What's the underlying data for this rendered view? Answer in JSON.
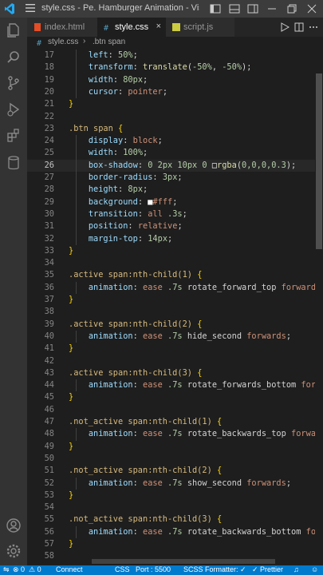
{
  "window": {
    "title": "style.css - Pe. Hamburger Animation - Visual Studio ..."
  },
  "tabs": [
    {
      "label": "index.html",
      "active": false,
      "icon": "html-file-icon",
      "icon_color": "#e44d26"
    },
    {
      "label": "style.css",
      "active": true,
      "icon": "css-file-icon",
      "icon_color": "#519aba",
      "close": "×"
    },
    {
      "label": "script.js",
      "active": false,
      "icon": "js-file-icon",
      "icon_color": "#cbcb41"
    }
  ],
  "breadcrumb": {
    "file": "style.css",
    "separator": "›",
    "selector": ".btn span"
  },
  "colors": {
    "property": "#9cdcfe",
    "value": "#ce9178",
    "number": "#b5cea8",
    "selector": "#d7ba7d",
    "function": "#dcdcaa",
    "keyword": "#569cd6",
    "text": "#d4d4d4",
    "bracket": "#ffd700",
    "statusbar": "#007acc"
  },
  "code": [
    {
      "n": "17",
      "t": [
        [
          "    ",
          "t"
        ],
        [
          "left",
          "p"
        ],
        [
          ": ",
          "t"
        ],
        [
          "50%",
          "nu"
        ],
        [
          ";",
          "t"
        ]
      ]
    },
    {
      "n": "18",
      "t": [
        [
          "    ",
          "t"
        ],
        [
          "transform",
          "p"
        ],
        [
          ": ",
          "t"
        ],
        [
          "translate",
          "f"
        ],
        [
          "(",
          "t"
        ],
        [
          "-50%",
          "nu"
        ],
        [
          ", ",
          "t"
        ],
        [
          "-50%",
          "nu"
        ],
        [
          ");",
          "t"
        ]
      ]
    },
    {
      "n": "19",
      "t": [
        [
          "    ",
          "t"
        ],
        [
          "width",
          "p"
        ],
        [
          ": ",
          "t"
        ],
        [
          "80px",
          "nu"
        ],
        [
          ";",
          "t"
        ]
      ]
    },
    {
      "n": "20",
      "t": [
        [
          "    ",
          "t"
        ],
        [
          "cursor",
          "p"
        ],
        [
          ": ",
          "t"
        ],
        [
          "pointer",
          "v"
        ],
        [
          ";",
          "t"
        ]
      ]
    },
    {
      "n": "21",
      "t": [
        [
          "}",
          "b"
        ]
      ]
    },
    {
      "n": "22",
      "t": []
    },
    {
      "n": "23",
      "t": [
        [
          ".btn span ",
          "s"
        ],
        [
          "{",
          "b"
        ]
      ]
    },
    {
      "n": "24",
      "t": [
        [
          "    ",
          "t"
        ],
        [
          "display",
          "p"
        ],
        [
          ": ",
          "t"
        ],
        [
          "block",
          "v"
        ],
        [
          ";",
          "t"
        ]
      ]
    },
    {
      "n": "25",
      "t": [
        [
          "    ",
          "t"
        ],
        [
          "width",
          "p"
        ],
        [
          ": ",
          "t"
        ],
        [
          "100%",
          "nu"
        ],
        [
          ";",
          "t"
        ]
      ]
    },
    {
      "n": "26",
      "t": [
        [
          "    ",
          "t"
        ],
        [
          "box-shadow",
          "p"
        ],
        [
          ": ",
          "t"
        ],
        [
          "0 2px 10px 0 ",
          "nu"
        ],
        [
          "□",
          "sw"
        ],
        [
          "rgba",
          "f"
        ],
        [
          "(",
          "t"
        ],
        [
          "0,0,0,0.3",
          "nu"
        ],
        [
          ");",
          "t"
        ]
      ],
      "current": true
    },
    {
      "n": "27",
      "t": [
        [
          "    ",
          "t"
        ],
        [
          "border-radius",
          "p"
        ],
        [
          ": ",
          "t"
        ],
        [
          "3px",
          "nu"
        ],
        [
          ";",
          "t"
        ]
      ]
    },
    {
      "n": "28",
      "t": [
        [
          "    ",
          "t"
        ],
        [
          "height",
          "p"
        ],
        [
          ": ",
          "t"
        ],
        [
          "8px",
          "nu"
        ],
        [
          ";",
          "t"
        ]
      ]
    },
    {
      "n": "29",
      "t": [
        [
          "    ",
          "t"
        ],
        [
          "background",
          "p"
        ],
        [
          ": ",
          "t"
        ],
        [
          "■",
          "sw2"
        ],
        [
          "#fff",
          "v"
        ],
        [
          ";",
          "t"
        ]
      ]
    },
    {
      "n": "30",
      "t": [
        [
          "    ",
          "t"
        ],
        [
          "transition",
          "p"
        ],
        [
          ": ",
          "t"
        ],
        [
          "all ",
          "v"
        ],
        [
          ".3s",
          "nu"
        ],
        [
          ";",
          "t"
        ]
      ]
    },
    {
      "n": "31",
      "t": [
        [
          "    ",
          "t"
        ],
        [
          "position",
          "p"
        ],
        [
          ": ",
          "t"
        ],
        [
          "relative",
          "v"
        ],
        [
          ";",
          "t"
        ]
      ]
    },
    {
      "n": "32",
      "t": [
        [
          "    ",
          "t"
        ],
        [
          "margin-top",
          "p"
        ],
        [
          ": ",
          "t"
        ],
        [
          "14px",
          "nu"
        ],
        [
          ";",
          "t"
        ]
      ]
    },
    {
      "n": "33",
      "t": [
        [
          "}",
          "b"
        ]
      ]
    },
    {
      "n": "34",
      "t": []
    },
    {
      "n": "35",
      "t": [
        [
          ".active span:nth-child(1) ",
          "s"
        ],
        [
          "{",
          "b"
        ]
      ]
    },
    {
      "n": "36",
      "t": [
        [
          "    ",
          "t"
        ],
        [
          "animation",
          "p"
        ],
        [
          ": ",
          "t"
        ],
        [
          "ease ",
          "v"
        ],
        [
          ".7s ",
          "nu"
        ],
        [
          "rotate_forward_top ",
          "t"
        ],
        [
          "forwards",
          "v"
        ],
        [
          ";",
          "t"
        ]
      ]
    },
    {
      "n": "37",
      "t": [
        [
          "}",
          "b"
        ]
      ]
    },
    {
      "n": "38",
      "t": []
    },
    {
      "n": "39",
      "t": [
        [
          ".active span:nth-child(2) ",
          "s"
        ],
        [
          "{",
          "b"
        ]
      ]
    },
    {
      "n": "40",
      "t": [
        [
          "    ",
          "t"
        ],
        [
          "animation",
          "p"
        ],
        [
          ": ",
          "t"
        ],
        [
          "ease ",
          "v"
        ],
        [
          ".7s ",
          "nu"
        ],
        [
          "hide_second ",
          "t"
        ],
        [
          "forwards",
          "v"
        ],
        [
          ";",
          "t"
        ]
      ]
    },
    {
      "n": "41",
      "t": [
        [
          "}",
          "b"
        ]
      ]
    },
    {
      "n": "42",
      "t": []
    },
    {
      "n": "43",
      "t": [
        [
          ".active span:nth-child(3) ",
          "s"
        ],
        [
          "{",
          "b"
        ]
      ]
    },
    {
      "n": "44",
      "t": [
        [
          "    ",
          "t"
        ],
        [
          "animation",
          "p"
        ],
        [
          ": ",
          "t"
        ],
        [
          "ease ",
          "v"
        ],
        [
          ".7s ",
          "nu"
        ],
        [
          "rotate_forwards_bottom ",
          "t"
        ],
        [
          "forwards",
          "v"
        ],
        [
          ";",
          "t"
        ]
      ]
    },
    {
      "n": "45",
      "t": [
        [
          "}",
          "b"
        ]
      ]
    },
    {
      "n": "46",
      "t": []
    },
    {
      "n": "47",
      "t": [
        [
          ".not_active span:nth-child(1) ",
          "s"
        ],
        [
          "{",
          "b"
        ]
      ]
    },
    {
      "n": "48",
      "t": [
        [
          "    ",
          "t"
        ],
        [
          "animation",
          "p"
        ],
        [
          ": ",
          "t"
        ],
        [
          "ease ",
          "v"
        ],
        [
          ".7s ",
          "nu"
        ],
        [
          "rotate_backwards_top ",
          "t"
        ],
        [
          "forwards",
          "v"
        ],
        [
          ";",
          "t"
        ]
      ]
    },
    {
      "n": "49",
      "t": [
        [
          "}",
          "b"
        ]
      ]
    },
    {
      "n": "50",
      "t": []
    },
    {
      "n": "51",
      "t": [
        [
          ".not_active span:nth-child(2) ",
          "s"
        ],
        [
          "{",
          "b"
        ]
      ]
    },
    {
      "n": "52",
      "t": [
        [
          "    ",
          "t"
        ],
        [
          "animation",
          "p"
        ],
        [
          ": ",
          "t"
        ],
        [
          "ease ",
          "v"
        ],
        [
          ".7s ",
          "nu"
        ],
        [
          "show_second ",
          "t"
        ],
        [
          "forwards",
          "v"
        ],
        [
          ";",
          "t"
        ]
      ]
    },
    {
      "n": "53",
      "t": [
        [
          "}",
          "b"
        ]
      ]
    },
    {
      "n": "54",
      "t": []
    },
    {
      "n": "55",
      "t": [
        [
          ".not_active span:nth-child(3) ",
          "s"
        ],
        [
          "{",
          "b"
        ]
      ]
    },
    {
      "n": "56",
      "t": [
        [
          "    ",
          "t"
        ],
        [
          "animation",
          "p"
        ],
        [
          ": ",
          "t"
        ],
        [
          "ease ",
          "v"
        ],
        [
          ".7s ",
          "nu"
        ],
        [
          "rotate_backwards_bottom ",
          "t"
        ],
        [
          "forwards",
          "v"
        ],
        [
          ";",
          "t"
        ]
      ]
    },
    {
      "n": "57",
      "t": [
        [
          "}",
          "b"
        ]
      ]
    },
    {
      "n": "58",
      "t": []
    }
  ],
  "statusbar": {
    "errors": "⊗ 0",
    "warnings": "⚠ 0",
    "connect": "Connect",
    "language": "CSS",
    "port": "Port : 5500",
    "formatter": "SCSS Formatter: ✓",
    "prettier": "✓ Prettier"
  }
}
